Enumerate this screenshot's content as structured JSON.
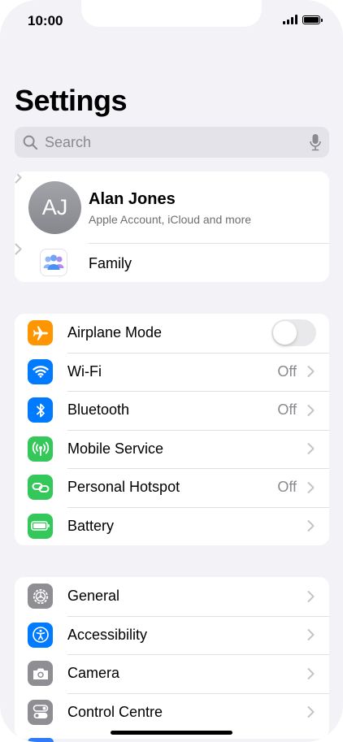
{
  "status_bar": {
    "time": "10:00"
  },
  "page": {
    "title": "Settings"
  },
  "search": {
    "placeholder": "Search"
  },
  "profile": {
    "initials": "AJ",
    "name": "Alan Jones",
    "subtitle": "Apple Account, iCloud and more",
    "family_label": "Family"
  },
  "connectivity": [
    {
      "label": "Airplane Mode",
      "icon": "airplane-icon",
      "color": "#ff9500",
      "toggle_on": false
    },
    {
      "label": "Wi-Fi",
      "icon": "wifi-icon",
      "color": "#007aff",
      "value": "Off"
    },
    {
      "label": "Bluetooth",
      "icon": "bluetooth-icon",
      "color": "#007aff",
      "value": "Off"
    },
    {
      "label": "Mobile Service",
      "icon": "antenna-icon",
      "color": "#34c759"
    },
    {
      "label": "Personal Hotspot",
      "icon": "link-icon",
      "color": "#34c759",
      "value": "Off"
    },
    {
      "label": "Battery",
      "icon": "battery-icon",
      "color": "#34c759"
    }
  ],
  "system": [
    {
      "label": "General",
      "icon": "gear-icon",
      "color": "#8e8e93"
    },
    {
      "label": "Accessibility",
      "icon": "accessibility-icon",
      "color": "#007aff"
    },
    {
      "label": "Camera",
      "icon": "camera-icon",
      "color": "#8e8e93"
    },
    {
      "label": "Control Centre",
      "icon": "toggles-icon",
      "color": "#8e8e93"
    }
  ]
}
